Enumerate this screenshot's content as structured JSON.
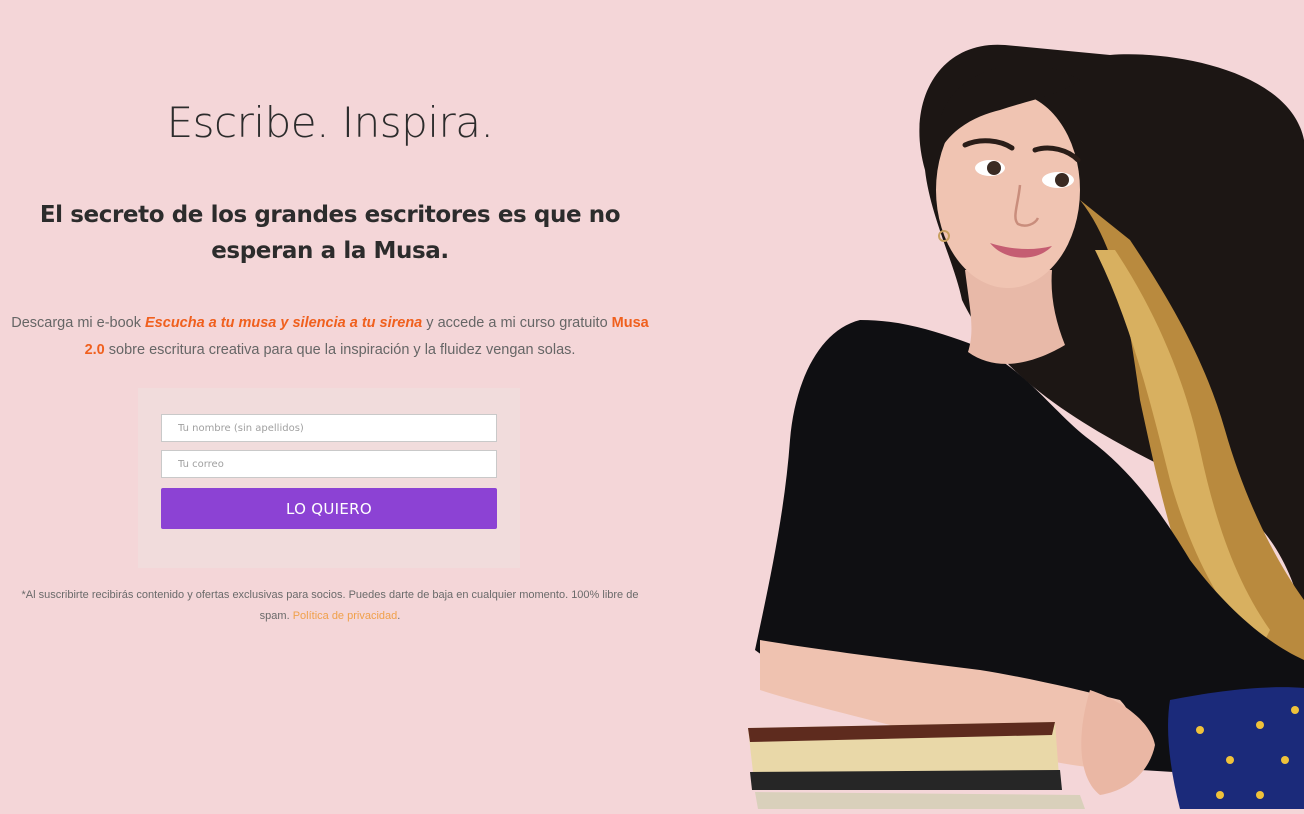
{
  "hero": {
    "title": "Escribe. Inspira.",
    "subtitle": "El secreto de los grandes escritores es que no esperan a la Musa."
  },
  "intro": {
    "prefix": "Descarga mi e-book ",
    "ebook_title": "Escucha a tu musa y silencia a tu sirena",
    "middle": " y accede a mi curso gratuito ",
    "course_name": "Musa 2.0",
    "suffix": " sobre escritura creativa para que la inspiración y la fluidez vengan solas."
  },
  "form": {
    "name_placeholder": "Tu nombre (sin apellidos)",
    "email_placeholder": "Tu correo",
    "submit_label": "LO QUIERO"
  },
  "disclaimer": {
    "text": "*Al suscribirte recibirás contenido y ofertas exclusivas para socios. Puedes darte de baja en cualquier momento. 100% libre de spam. ",
    "privacy_link": "Política de privacidad",
    "end": "."
  },
  "colors": {
    "background": "#f4d6d8",
    "accent_orange": "#f0601e",
    "button_purple": "#8c42d4",
    "link_orange": "#f0a04a"
  },
  "photo": {
    "icon": "author-portrait"
  }
}
